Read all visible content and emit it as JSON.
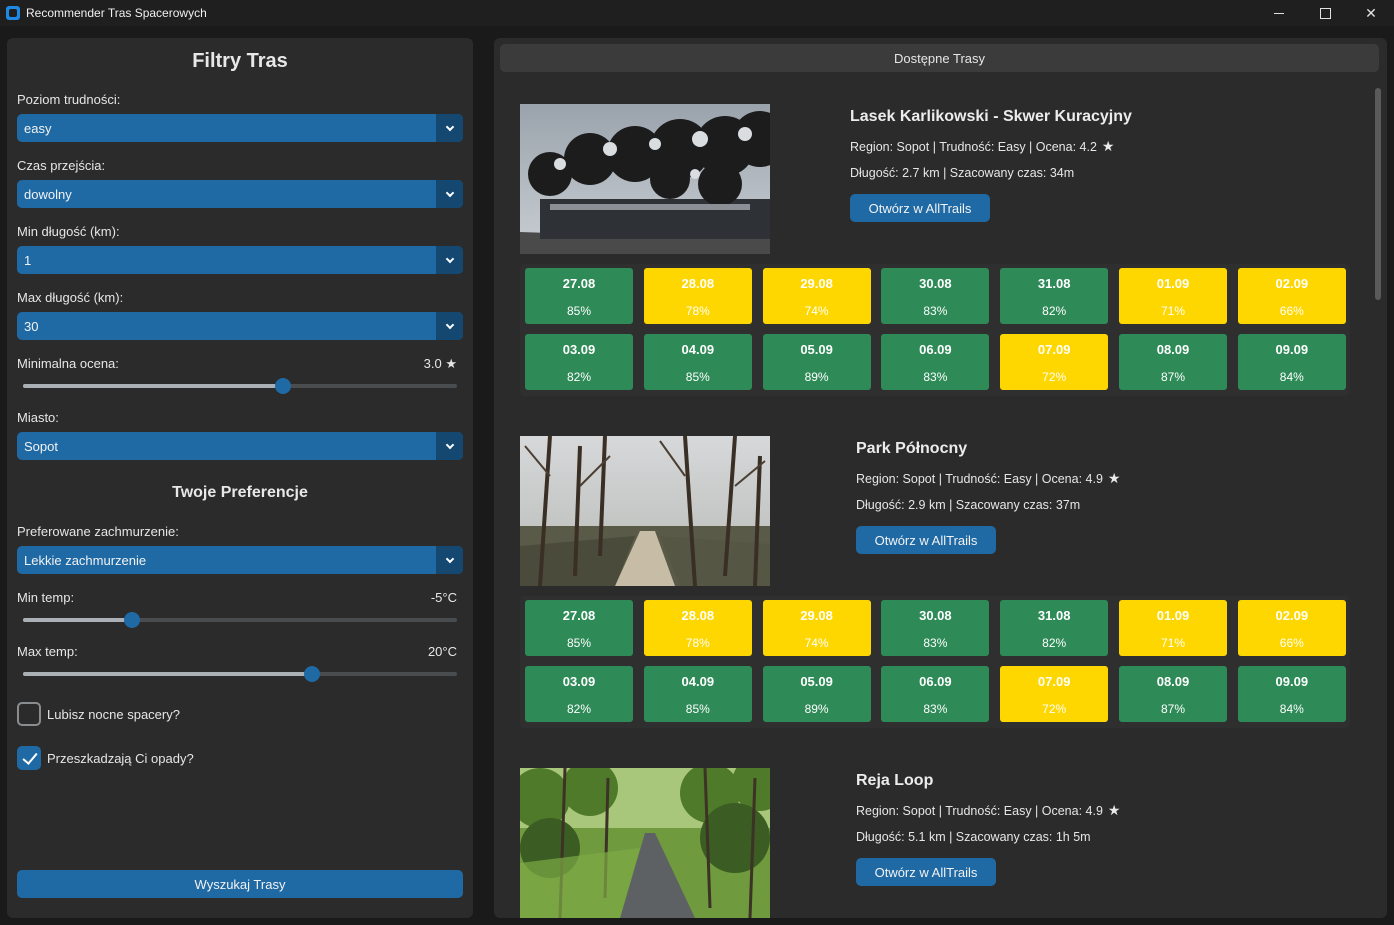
{
  "window": {
    "title": "Recommender Tras Spacerowych",
    "minimize": "",
    "maximize": "",
    "close": "✕"
  },
  "filters": {
    "title": "Filtry Tras",
    "difficulty": {
      "label": "Poziom trudności:",
      "value": "easy"
    },
    "time": {
      "label": "Czas przejścia:",
      "value": "dowolny"
    },
    "min_length": {
      "label": "Min długość (km):",
      "value": "1"
    },
    "max_length": {
      "label": "Max długość (km):",
      "value": "30"
    },
    "min_rating": {
      "label": "Minimalna ocena:",
      "value": "3.0",
      "level": 0.6
    },
    "city": {
      "label": "Miasto:",
      "value": "Sopot"
    }
  },
  "preferences": {
    "title": "Twoje Preferencje",
    "cloud": {
      "label": "Preferowane zachmurzenie:",
      "value": "Lekkie zachmurzenie"
    },
    "min_temp": {
      "label": "Min temp:",
      "value": "-5°C",
      "level": 0.25
    },
    "max_temp": {
      "label": "Max temp:",
      "value": "20°C",
      "level": 0.667
    },
    "night_walks": {
      "label": "Lubisz nocne spacery?",
      "checked": false
    },
    "rain": {
      "label": "Przeszkadzają Ci opady?",
      "checked": true
    }
  },
  "search_button": "Wyszukaj Trasy",
  "results": {
    "header": "Dostępne Trasy",
    "trails": [
      {
        "name": "Lasek Karlikowski - Skwer Kuracyjny",
        "info1": "Region: Sopot | Trudność: Easy | Ocena: 4.2",
        "info2": "Długość: 2.7 km | Szacowany czas: 34m",
        "button": "Otwórz w AllTrails",
        "days": [
          {
            "date": "27.08",
            "pct": "85%",
            "status": "green"
          },
          {
            "date": "28.08",
            "pct": "78%",
            "status": "yellow"
          },
          {
            "date": "29.08",
            "pct": "74%",
            "status": "yellow"
          },
          {
            "date": "30.08",
            "pct": "83%",
            "status": "green"
          },
          {
            "date": "31.08",
            "pct": "82%",
            "status": "green"
          },
          {
            "date": "01.09",
            "pct": "71%",
            "status": "yellow"
          },
          {
            "date": "02.09",
            "pct": "66%",
            "status": "yellow"
          },
          {
            "date": "03.09",
            "pct": "82%",
            "status": "green"
          },
          {
            "date": "04.09",
            "pct": "85%",
            "status": "green"
          },
          {
            "date": "05.09",
            "pct": "89%",
            "status": "green"
          },
          {
            "date": "06.09",
            "pct": "83%",
            "status": "green"
          },
          {
            "date": "07.09",
            "pct": "72%",
            "status": "yellow"
          },
          {
            "date": "08.09",
            "pct": "87%",
            "status": "green"
          },
          {
            "date": "09.09",
            "pct": "84%",
            "status": "green"
          }
        ]
      },
      {
        "name": "Park Północny",
        "info1": "Region: Sopot | Trudność: Easy | Ocena: 4.9",
        "info2": "Długość: 2.9 km | Szacowany czas: 37m",
        "button": "Otwórz w AllTrails",
        "days": [
          {
            "date": "27.08",
            "pct": "85%",
            "status": "green"
          },
          {
            "date": "28.08",
            "pct": "78%",
            "status": "yellow"
          },
          {
            "date": "29.08",
            "pct": "74%",
            "status": "yellow"
          },
          {
            "date": "30.08",
            "pct": "83%",
            "status": "green"
          },
          {
            "date": "31.08",
            "pct": "82%",
            "status": "green"
          },
          {
            "date": "01.09",
            "pct": "71%",
            "status": "yellow"
          },
          {
            "date": "02.09",
            "pct": "66%",
            "status": "yellow"
          },
          {
            "date": "03.09",
            "pct": "82%",
            "status": "green"
          },
          {
            "date": "04.09",
            "pct": "85%",
            "status": "green"
          },
          {
            "date": "05.09",
            "pct": "89%",
            "status": "green"
          },
          {
            "date": "06.09",
            "pct": "83%",
            "status": "green"
          },
          {
            "date": "07.09",
            "pct": "72%",
            "status": "yellow"
          },
          {
            "date": "08.09",
            "pct": "87%",
            "status": "green"
          },
          {
            "date": "09.09",
            "pct": "84%",
            "status": "green"
          }
        ]
      },
      {
        "name": "Reja Loop",
        "info1": "Region: Sopot | Trudność: Easy | Ocena: 4.9",
        "info2": "Długość: 5.1 km | Szacowany czas: 1h 5m",
        "button": "Otwórz w AllTrails",
        "days": []
      }
    ]
  },
  "colors": {
    "accent": "#1f6aa5",
    "good": "#2e8b57",
    "medium": "#ffd700",
    "panel": "#2b2b2b"
  }
}
